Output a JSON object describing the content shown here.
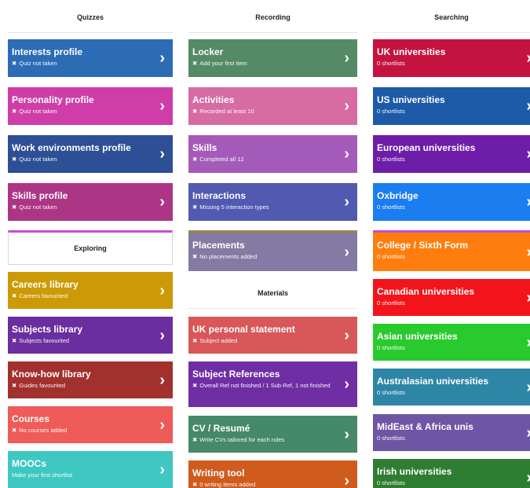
{
  "columns": {
    "quizzes": {
      "title": "Quizzes",
      "cards": [
        {
          "title": "Interests profile",
          "status": "Quiz not taken",
          "color": "#2b6cb5"
        },
        {
          "title": "Personality profile",
          "status": "Quiz not taken",
          "color": "#cf3ea8"
        },
        {
          "title": "Work environments profile",
          "status": "Quiz not taken",
          "color": "#2d4f96"
        },
        {
          "title": "Skills profile",
          "status": "Quiz not taken",
          "color": "#ad3585"
        }
      ]
    },
    "exploring": {
      "title": "Exploring",
      "cards": [
        {
          "title": "Careers library",
          "status": "Careers favourited",
          "color": "#cc9a06"
        },
        {
          "title": "Subjects library",
          "status": "Subjects favourited",
          "color": "#6b2e9e"
        },
        {
          "title": "Know-how library",
          "status": "Guides favourited",
          "color": "#a2302c"
        },
        {
          "title": "Courses",
          "status": "No courses added",
          "color": "#ee5b58"
        },
        {
          "title": "MOOCs",
          "status": "Make your first shortlist",
          "color": "#3ec8c1"
        }
      ]
    },
    "recording": {
      "title": "Recording",
      "cards": [
        {
          "title": "Locker",
          "status": "Add your first item",
          "color": "#548a64"
        },
        {
          "title": "Activities",
          "status": "Recorded at least 10",
          "color": "#d76ba4"
        },
        {
          "title": "Skills",
          "status": "Completed all 12",
          "color": "#a45ab8"
        },
        {
          "title": "Interactions",
          "status": "Missing 5 interaction types",
          "color": "#5159b0"
        },
        {
          "title": "Placements",
          "status": "No placements added",
          "color": "#847aa4"
        }
      ]
    },
    "materials": {
      "title": "Materials",
      "cards": [
        {
          "title": "UK personal statement",
          "status": "Subject added",
          "color": "#d85758"
        },
        {
          "title": "Subject References",
          "status": "Overall Ref not finished / 1 Sub Ref, 1 not finished",
          "color": "#6f2ea4"
        },
        {
          "title": "CV / Resumé",
          "status": "Write CVs tailored for each roles",
          "color": "#45896a"
        },
        {
          "title": "Writing tool",
          "status": "0 writing items added",
          "color": "#cf5b1d"
        }
      ]
    },
    "searching": {
      "title": "Searching",
      "cards": [
        {
          "title": "UK universities",
          "status": "0 shortlists",
          "color": "#c4133f"
        },
        {
          "title": "US universities",
          "status": "0 shortlists",
          "color": "#1d5aa8"
        },
        {
          "title": "European universities",
          "status": "0 shortlists",
          "color": "#6d1da8"
        },
        {
          "title": "Oxbridge",
          "status": "0 shortlists",
          "color": "#1a7df0"
        },
        {
          "title": "College / Sixth Form",
          "status": "0 shortlists",
          "color": "#ff7d0e"
        },
        {
          "title": "Canadian universities",
          "status": "0 shortlists",
          "color": "#f2141a"
        },
        {
          "title": "Asian universities",
          "status": "0 shortlists",
          "color": "#29ca2d"
        },
        {
          "title": "Australasian universities",
          "status": "0 shortlists",
          "color": "#2e86a6"
        },
        {
          "title": "MidEast & Africa unis",
          "status": "0 shortlists",
          "color": "#6e56a4"
        },
        {
          "title": "Irish universities",
          "status": "0 shortlists",
          "color": "#2f7d32"
        }
      ]
    }
  },
  "icons": {
    "cross": "✖",
    "chevron": "›"
  }
}
